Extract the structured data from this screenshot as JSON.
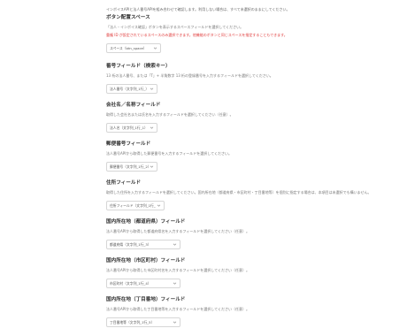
{
  "intro": "インボイスAPIと法人番号APIを組み合わせて確認します。利用しない場合は、すべて未選択のままにしてください。",
  "sections": [
    {
      "title": "ボタン配置スペース",
      "desc": "「法人・インボイス確認」ボタンを表示するスペースフィールドを選択してください。",
      "warn": "重複 ID が設定されているスペースのみ選択できます。他機能のボタンと同じスペースを指定することもできます。",
      "value": "スペース（btn_space）"
    },
    {
      "title": "番号フィールド（検索キー）",
      "desc": "13 桁の法人番号、または「T」+ 半角数字 13 桁の登録番号を入力するフィールドを選択してください。",
      "value": "法人番号（文字列_1行_）"
    },
    {
      "title": "会社名／名称フィールド",
      "desc": "取得した会社名または氏名を入力するフィールドを選択してください（任意）。",
      "value": "法人名（文字列_1行_1）"
    },
    {
      "title": "郵便番号フィールド",
      "desc": "法人番号APIから取得した郵便番号を入力するフィールドを選択してください。",
      "value": "郵便番号（文字列_1行_2）"
    },
    {
      "title": "住所フィールド",
      "desc": "取得した住所を入力するフィールドを選択してください。国内所在地（都道府県・市区町村・丁目番地等）を個別に指定する場合は、本項目は未選択でも構いません。",
      "value": "住所フィールド（文字列_1行_3）"
    },
    {
      "title": "国内所在地（都道府県）フィールド",
      "desc": "法人番号APIから取得した都道府県名を入力するフィールドを選択してください（任意）。",
      "value": "都道府県（文字列_1行_3）"
    },
    {
      "title": "国内所在地（市区町村）フィールド",
      "desc": "法人番号APIから取得した市区町村名を入力するフィールドを選択してください（任意）。",
      "value": "市区町村（文字列_1行_4）"
    },
    {
      "title": "国内所在地（丁目番地）フィールド",
      "desc": "法人番号APIから取得した丁目番地等を入力するフィールドを選択してください（任意）。",
      "value": "丁目番地等（文字列_1行_5）"
    }
  ],
  "icons": {
    "select_chevron": "chevron-down-icon"
  },
  "colors": {
    "warning": "#e03c3c"
  }
}
